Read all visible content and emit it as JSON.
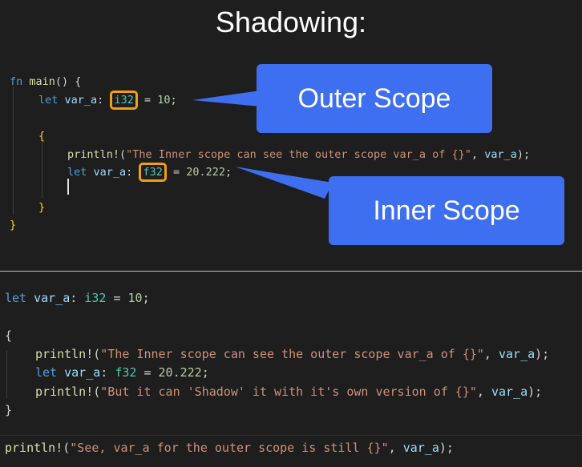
{
  "title": "Shadowing:",
  "callouts": {
    "outer": "Outer Scope",
    "inner": "Inner Scope"
  },
  "top_code": {
    "l1_fn": "fn",
    "l1_main": "main",
    "l1_rest": "() {",
    "l2_let": "let",
    "l2_var": "var_a",
    "l2_colon": ": ",
    "l2_type": "i32",
    "l2_eq": " = ",
    "l2_num": "10",
    "l2_semi": ";",
    "l4_brace": "{",
    "l5_fn": "println!",
    "l5_open": "(",
    "l5_str": "\"The Inner scope can see the outer scope var_a of {}\"",
    "l5_mid": ", ",
    "l5_var": "var_a",
    "l5_close": ");",
    "l6_let": "let",
    "l6_var": "var_a",
    "l6_colon": ": ",
    "l6_type": "f32",
    "l6_eq": " = ",
    "l6_num": "20.222",
    "l6_semi": ";",
    "l8_brace": "}",
    "l9_brace": "}"
  },
  "bottom_code": {
    "b1_let": "let",
    "b1_var": "var_a",
    "b1_colon": ": ",
    "b1_type": "i32",
    "b1_eq": " = ",
    "b1_num": "10",
    "b1_semi": ";",
    "b3_brace": "{",
    "b4_fn": "println!",
    "b4_open": "(",
    "b4_str": "\"The Inner scope can see the outer scope var_a of {}\"",
    "b4_mid": ", ",
    "b4_var": "var_a",
    "b4_close": ");",
    "b5_let": "let",
    "b5_var": "var_a",
    "b5_colon": ": ",
    "b5_type": "f32",
    "b5_eq": " = ",
    "b5_num": "20.222",
    "b5_semi": ";",
    "b6_fn": "println!",
    "b6_open": "(",
    "b6_str": "\"But it can 'Shadow' it with it's own version of {}\"",
    "b6_mid": ", ",
    "b6_var": "var_a",
    "b6_close": ");",
    "b7_brace": "}",
    "b9_fn": "println!",
    "b9_open": "(",
    "b9_str": "\"See, var_a for the outer scope is still {}\"",
    "b9_mid": ", ",
    "b9_var": "var_a",
    "b9_close": ");"
  },
  "colors": {
    "callout_bg": "#3d6ff0",
    "highlight_border": "#f0a012"
  }
}
